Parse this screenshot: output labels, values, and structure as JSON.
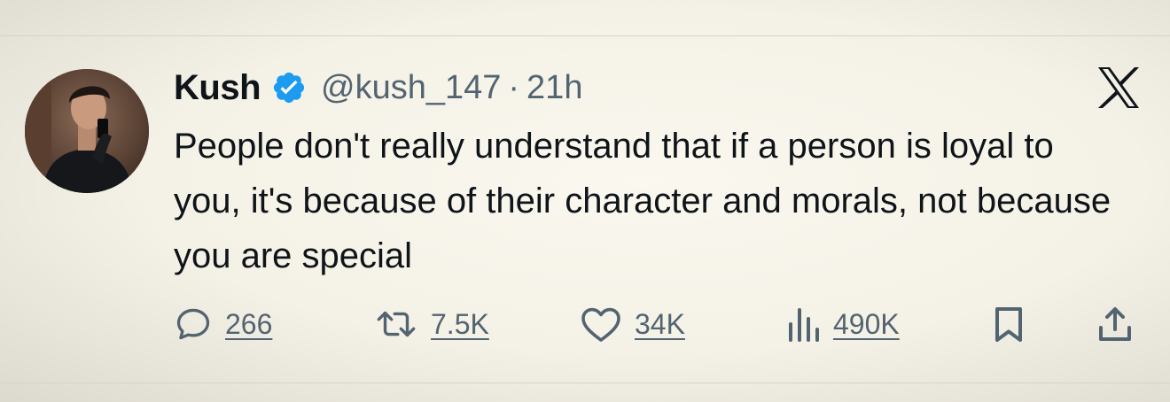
{
  "tweet": {
    "author_name": "Kush",
    "handle": "@kush_147",
    "separator": "·",
    "time": "21h",
    "text": "People don't really understand that if a person is loyal to you, it's because of their character and morals, not because you are special"
  },
  "actions": {
    "replies": "266",
    "reposts": "7.5K",
    "likes": "34K",
    "views": "490K"
  },
  "icons": {
    "verified": "verified-badge-icon",
    "brand": "x-logo-icon",
    "reply": "reply-icon",
    "repost": "repost-icon",
    "like": "heart-icon",
    "views": "views-icon",
    "bookmark": "bookmark-icon",
    "share": "share-icon"
  },
  "colors": {
    "text": "#0f1419",
    "secondary": "#536471",
    "verified": "#1d9bf0",
    "background": "#f4f1e6"
  }
}
